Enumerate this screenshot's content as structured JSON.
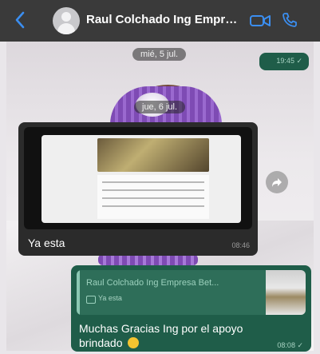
{
  "header": {
    "back_icon": "chevron-left-icon",
    "contact_name": "Raul Colchado  Ing Empre...",
    "video_icon": "video-call-icon",
    "phone_icon": "phone-icon"
  },
  "dates": [
    "mié, 5 jul.",
    "jue, 6 jul."
  ],
  "messages": {
    "outgoing_small": {
      "time": "19:45 ✓"
    },
    "incoming_image": {
      "caption": "Ya esta",
      "time": "08:46"
    },
    "outgoing_reply": {
      "quoted_name": "Raul Colchado  Ing Empresa Bet...",
      "quoted_text": "Ya esta",
      "text": "Muchas Gracias Ing por el apoyo brindado",
      "time": "08:08 ✓"
    }
  },
  "colors": {
    "header": "#3a3a3a",
    "accent_blue": "#3b8ef0",
    "outgoing": "#1f5d49",
    "incoming": "#2b2b2b"
  }
}
